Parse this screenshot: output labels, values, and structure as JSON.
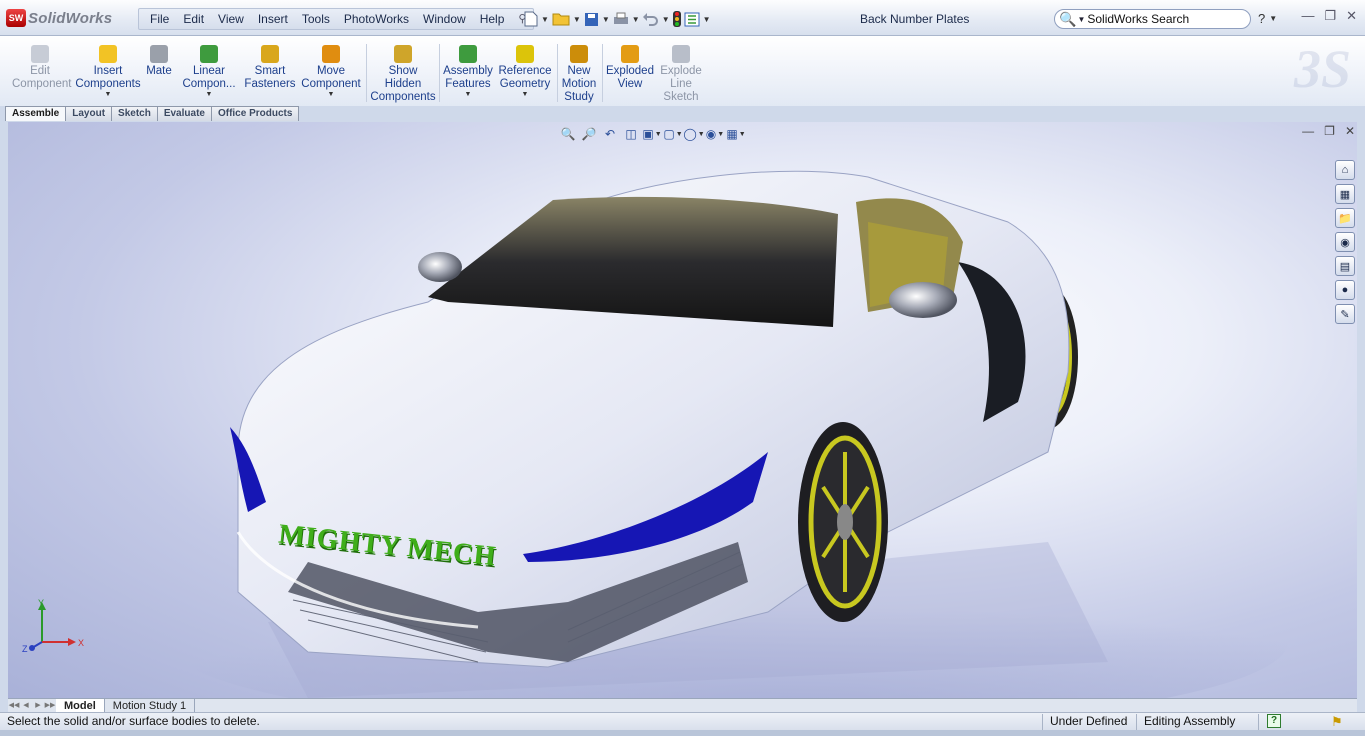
{
  "app": {
    "logo_mark": "SW",
    "logo_text": "SolidWorks",
    "document_title": "Back Number Plates"
  },
  "menu": [
    "File",
    "Edit",
    "View",
    "Insert",
    "Tools",
    "PhotoWorks",
    "Window",
    "Help"
  ],
  "search": {
    "text": "SolidWorks Search"
  },
  "help_label": "?",
  "ribbon": [
    {
      "label": "Edit\nComponent",
      "disabled": true,
      "dropdown": false,
      "color": "#9aa3b3"
    },
    {
      "label": "Insert\nComponents",
      "disabled": false,
      "dropdown": true,
      "color": "#e8b800"
    },
    {
      "label": "Mate",
      "disabled": false,
      "dropdown": false,
      "color": "#7b7f86"
    },
    {
      "label": "Linear\nCompon...",
      "disabled": false,
      "dropdown": true,
      "color": "#2e8b2e"
    },
    {
      "label": "Smart\nFasteners",
      "disabled": false,
      "dropdown": false,
      "color": "#d4a017"
    },
    {
      "label": "Move\nComponent",
      "disabled": false,
      "dropdown": true,
      "color": "#d88a00"
    },
    {
      "label": "Show\nHidden\nComponents",
      "disabled": false,
      "dropdown": false,
      "color": "#c9a227"
    },
    {
      "label": "Assembly\nFeatures",
      "disabled": false,
      "dropdown": true,
      "color": "#3b9a3b"
    },
    {
      "label": "Reference\nGeometry",
      "disabled": false,
      "dropdown": true,
      "color": "#d9c200"
    },
    {
      "label": "New\nMotion\nStudy",
      "disabled": false,
      "dropdown": false,
      "color": "#c98a00"
    },
    {
      "label": "Exploded\nView",
      "disabled": false,
      "dropdown": false,
      "color": "#e09a10"
    },
    {
      "label": "Explode\nLine\nSketch",
      "disabled": true,
      "dropdown": false,
      "color": "#a9b0bd"
    }
  ],
  "tabs": [
    "Assemble",
    "Layout",
    "Sketch",
    "Evaluate",
    "Office Products"
  ],
  "model": {
    "text": "MIGHTY MECH"
  },
  "triad": {
    "x": "X",
    "y": "Y",
    "z": "Z"
  },
  "bottom_tabs": [
    "Model",
    "Motion Study 1"
  ],
  "status": {
    "message": "Select the solid and/or surface bodies to delete.",
    "state": "Under Defined",
    "mode": "Editing Assembly"
  },
  "colors": {
    "accent": "#1d3f8c",
    "body": "#eef1f8",
    "lamp": "#1616b4",
    "wheel": "#c8c820",
    "text_3d": "#3fae1a"
  }
}
